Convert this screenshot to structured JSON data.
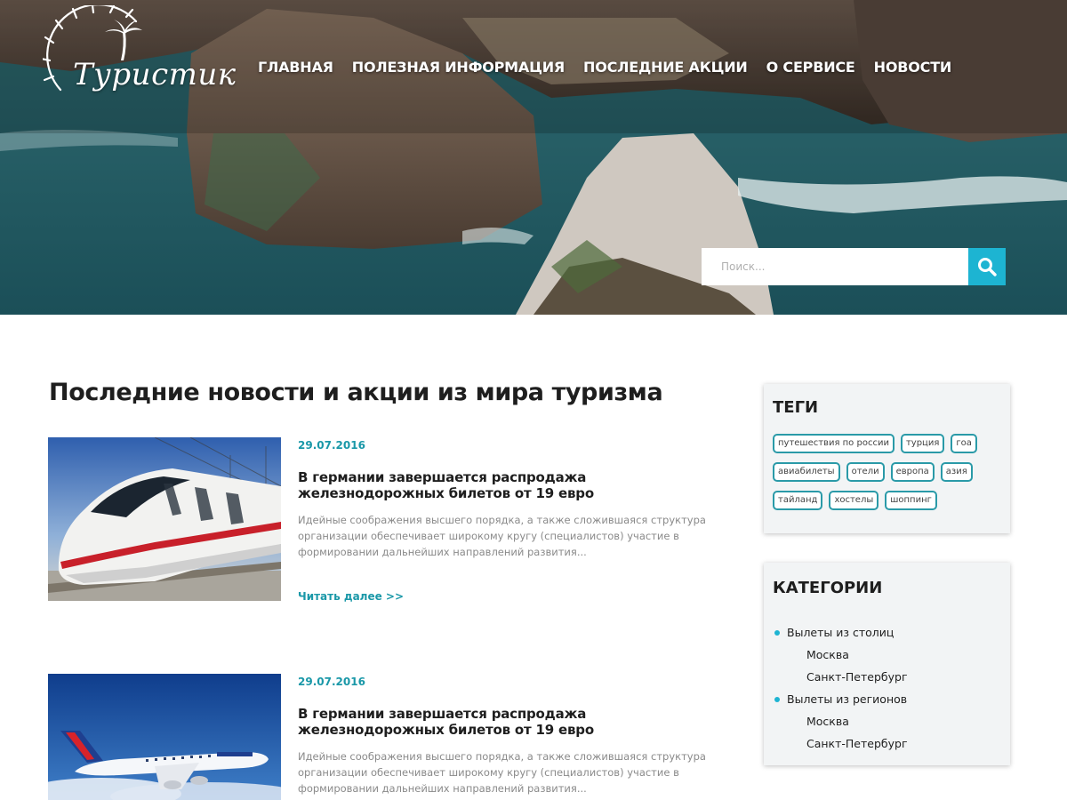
{
  "brand": {
    "logo_text": "Туристик"
  },
  "nav": {
    "items": [
      "ГЛАВНАЯ",
      "ПОЛЕЗНАЯ ИНФОРМАЦИЯ",
      "ПОСЛЕДНИЕ АКЦИИ",
      "О СЕРВИСЕ",
      "НОВОСТИ"
    ]
  },
  "search": {
    "placeholder": "Поиск...",
    "value": ""
  },
  "main": {
    "title": "Последние новости и акции из мира туризма",
    "posts": [
      {
        "date": "29.07.2016",
        "title": "В германии завершается распродажа железнодорожных билетов от 19 евро",
        "excerpt": "Идейные соображения высшего порядка, а также сложившаяся структура организации обеспечивает широкому кругу (специалистов) участие в формировании дальнейших направлений развития...",
        "more": "Читать далее >>",
        "image": "train"
      },
      {
        "date": "29.07.2016",
        "title": "В германии завершается распродажа железнодорожных билетов от 19 евро",
        "excerpt": "Идейные соображения высшего порядка, а также сложившаяся структура организации обеспечивает широкому кругу (специалистов) участие в формировании дальнейших направлений развития...",
        "image": "airplane"
      }
    ]
  },
  "sidebar": {
    "tags": {
      "title": "ТЕГИ",
      "rows": [
        [
          "путешествия по россии",
          "турция",
          "гоа"
        ],
        [
          "авиабилеты",
          "отели",
          "европа",
          "азия"
        ],
        [
          "тайланд",
          "хостелы",
          "шоппинг"
        ]
      ]
    },
    "categories": {
      "title": "КАТЕГОРИИ",
      "items": [
        {
          "label": "Вылеты из столиц",
          "children": [
            "Москва",
            "Санкт-Петербург"
          ]
        },
        {
          "label": "Вылеты из регионов",
          "children": [
            "Москва",
            "Санкт-Петербург"
          ]
        }
      ]
    }
  },
  "colors": {
    "accent": "#1db4d2",
    "link": "#1a98a8",
    "tag_border": "#2a9aa8"
  },
  "icons": {
    "search": "search-icon",
    "bullet": "bullet-dot-icon"
  }
}
